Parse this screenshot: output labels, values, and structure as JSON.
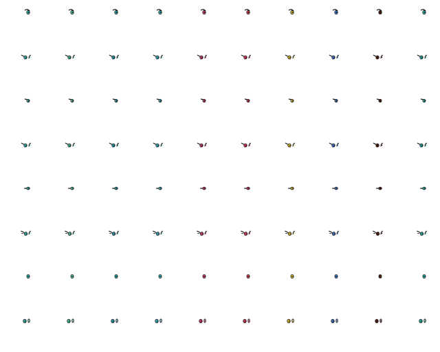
{
  "sprite_sheet": {
    "columns": 10,
    "rows": 8,
    "eye_colors": [
      "#33b9ae",
      "#4fc8a1",
      "#2aa7b4",
      "#39b7c8",
      "#d83c7a",
      "#e23b5a",
      "#e0be2e",
      "#3e7dd4",
      "#5a1d12",
      "#22b6a6"
    ],
    "row_poses": [
      "eye-forward",
      "pair-wide",
      "eye-side",
      "pair-wide",
      "eye-narrow",
      "pair-brow",
      "eye-dot",
      "pair-close"
    ],
    "outline_color": "#1a1a1a"
  }
}
